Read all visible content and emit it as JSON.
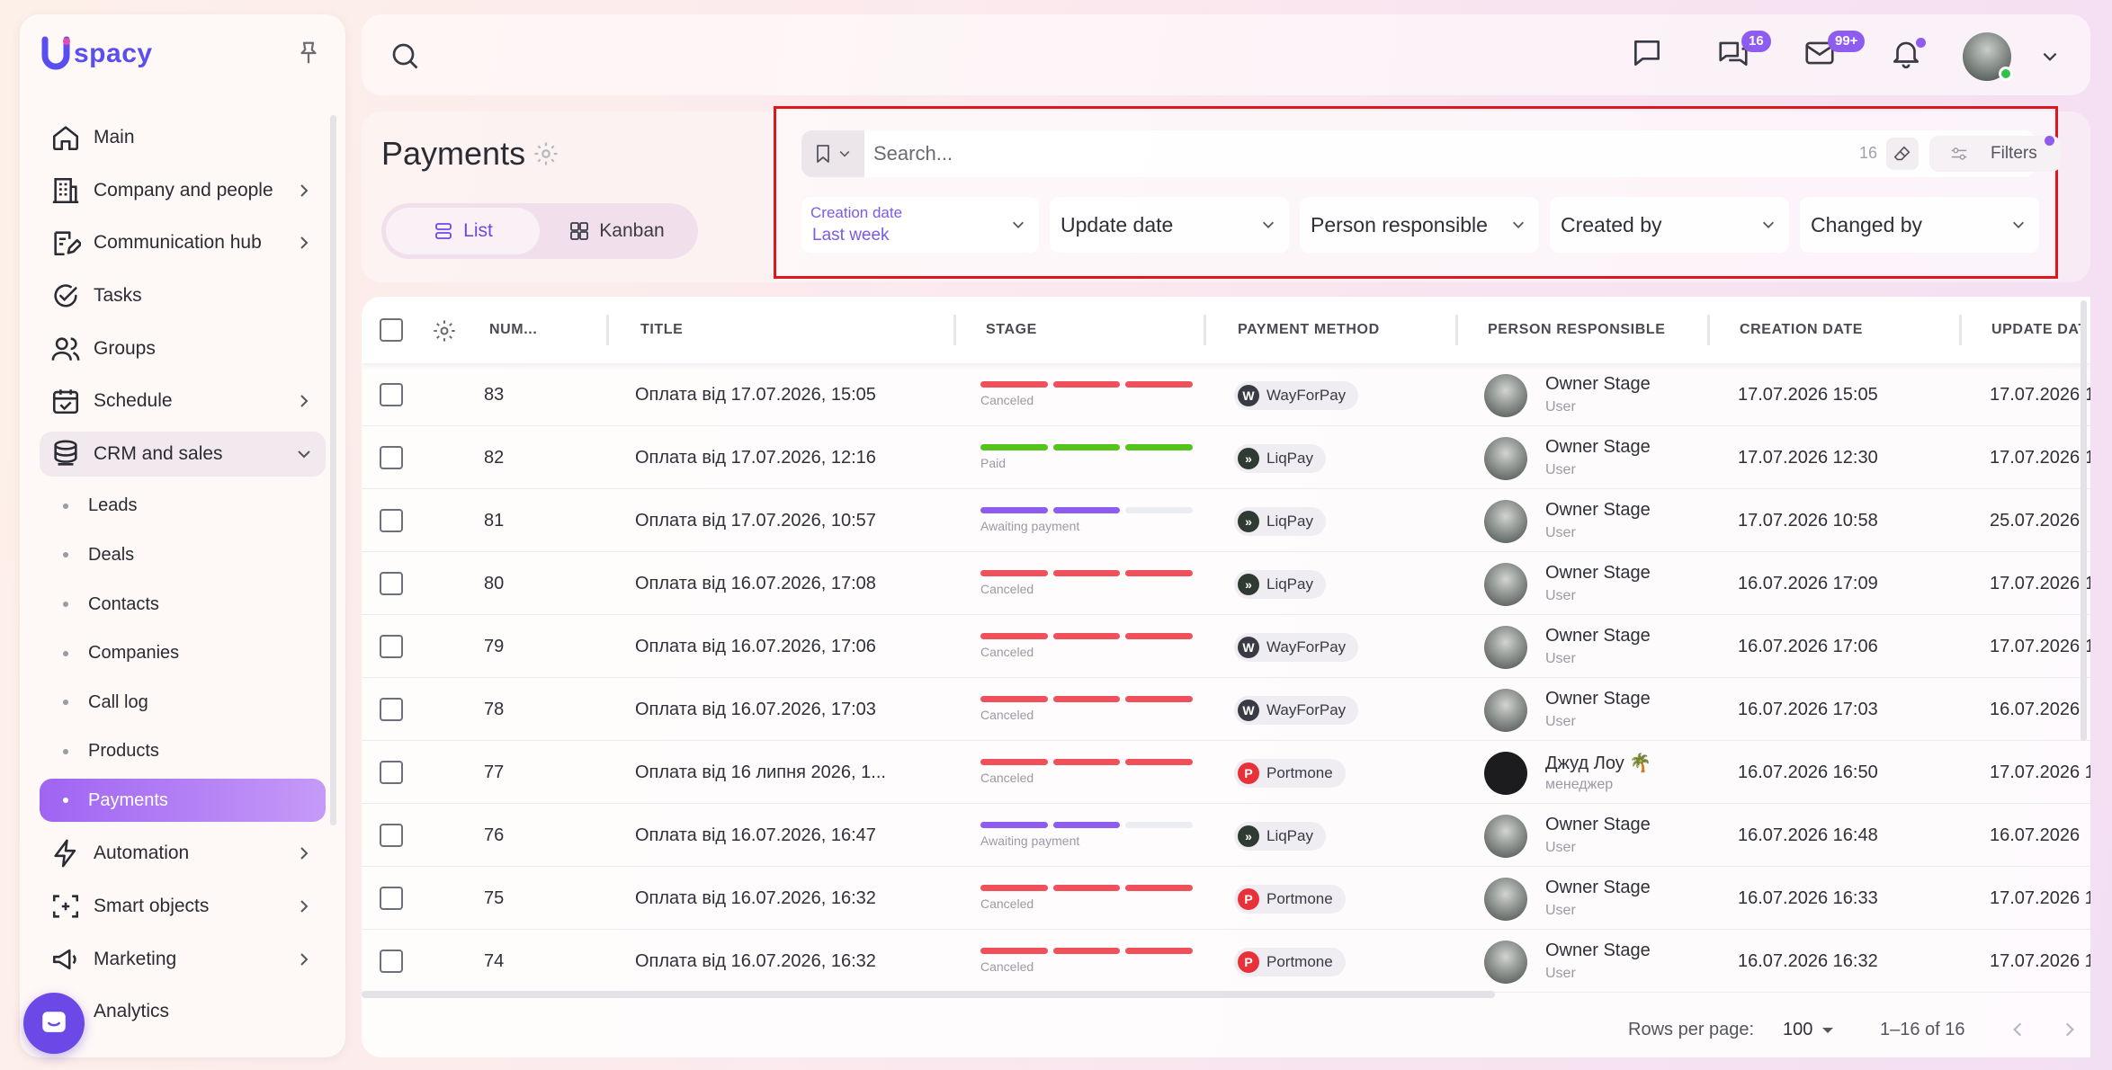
{
  "app": {
    "logo_text": "spacy"
  },
  "sidebar": {
    "items": [
      {
        "label": "Main",
        "icon": "home-icon",
        "chevron": false
      },
      {
        "label": "Company and people",
        "icon": "building-icon",
        "chevron": true
      },
      {
        "label": "Communication hub",
        "icon": "edit-note-icon",
        "chevron": true
      },
      {
        "label": "Tasks",
        "icon": "check-circle-icon",
        "chevron": false
      },
      {
        "label": "Groups",
        "icon": "people-icon",
        "chevron": false
      },
      {
        "label": "Schedule",
        "icon": "calendar-icon",
        "chevron": true
      },
      {
        "label": "CRM and sales",
        "icon": "database-icon",
        "chevron": true
      }
    ],
    "crm_sub": [
      "Leads",
      "Deals",
      "Contacts",
      "Companies",
      "Call log",
      "Products",
      "Payments"
    ],
    "after": [
      {
        "label": "Automation",
        "icon": "lightning-icon"
      },
      {
        "label": "Smart objects",
        "icon": "smart-object-icon"
      },
      {
        "label": "Marketing",
        "icon": "megaphone-icon"
      },
      {
        "label": "Analytics",
        "icon": "chart-icon"
      }
    ]
  },
  "topbar": {
    "chat_badge": "16",
    "mail_badge": "99+"
  },
  "page": {
    "title": "Payments",
    "views": {
      "list": "List",
      "kanban": "Kanban"
    }
  },
  "search": {
    "placeholder": "Search...",
    "count": "16",
    "filters_label": "Filters"
  },
  "filters": {
    "creation_date_label": "Creation date",
    "creation_date_value": "Last week",
    "update_date": "Update date",
    "person_responsible": "Person responsible",
    "created_by": "Created by",
    "changed_by": "Changed by"
  },
  "table": {
    "headers": {
      "number": "NUM...",
      "title": "TITLE",
      "stage": "STAGE",
      "payment_method": "PAYMENT METHOD",
      "person": "PERSON RESPONSIBLE",
      "created": "CREATION DATE",
      "updated": "UPDATE DAT"
    },
    "rows": [
      {
        "num": "83",
        "title": "Оплата від 17.07.2026, 15:05",
        "stage": "Canceled",
        "method": "WayForPay",
        "person": "Owner Stage",
        "role": "User",
        "created": "17.07.2026 15:05",
        "updated": "17.07.2026 1"
      },
      {
        "num": "82",
        "title": "Оплата від 17.07.2026, 12:16",
        "stage": "Paid",
        "method": "LiqPay",
        "person": "Owner Stage",
        "role": "User",
        "created": "17.07.2026 12:30",
        "updated": "17.07.2026 1"
      },
      {
        "num": "81",
        "title": "Оплата від 17.07.2026, 10:57",
        "stage": "Awaiting payment",
        "method": "LiqPay",
        "person": "Owner Stage",
        "role": "User",
        "created": "17.07.2026 10:58",
        "updated": "25.07.2026"
      },
      {
        "num": "80",
        "title": "Оплата від 16.07.2026, 17:08",
        "stage": "Canceled",
        "method": "LiqPay",
        "person": "Owner Stage",
        "role": "User",
        "created": "16.07.2026 17:09",
        "updated": "17.07.2026 1"
      },
      {
        "num": "79",
        "title": "Оплата від 16.07.2026, 17:06",
        "stage": "Canceled",
        "method": "WayForPay",
        "person": "Owner Stage",
        "role": "User",
        "created": "16.07.2026 17:06",
        "updated": "17.07.2026 1"
      },
      {
        "num": "78",
        "title": "Оплата від 16.07.2026, 17:03",
        "stage": "Canceled",
        "method": "WayForPay",
        "person": "Owner Stage",
        "role": "User",
        "created": "16.07.2026 17:03",
        "updated": "16.07.2026"
      },
      {
        "num": "77",
        "title": "Оплата від 16 липня 2026, 1...",
        "stage": "Canceled",
        "method": "Portmone",
        "person": "Джуд Лоу 🌴",
        "role": "менеджер",
        "created": "16.07.2026 16:50",
        "updated": "17.07.2026 1"
      },
      {
        "num": "76",
        "title": "Оплата від 16.07.2026, 16:47",
        "stage": "Awaiting payment",
        "method": "LiqPay",
        "person": "Owner Stage",
        "role": "User",
        "created": "16.07.2026 16:48",
        "updated": "16.07.2026"
      },
      {
        "num": "75",
        "title": "Оплата від 16.07.2026, 16:32",
        "stage": "Canceled",
        "method": "Portmone",
        "person": "Owner Stage",
        "role": "User",
        "created": "16.07.2026 16:33",
        "updated": "17.07.2026 1"
      },
      {
        "num": "74",
        "title": "Оплата від 16.07.2026, 16:32",
        "stage": "Canceled",
        "method": "Portmone",
        "person": "Owner Stage",
        "role": "User",
        "created": "16.07.2026 16:32",
        "updated": "17.07.2026 1"
      }
    ]
  },
  "pagination": {
    "rows_per_page_label": "Rows per page:",
    "rows_per_page": "100",
    "range": "1–16 of 16"
  },
  "colors": {
    "accent": "#8f5cf0",
    "canceled": "#f0505a",
    "paid": "#52c41a",
    "awaiting": "#8f5cf0",
    "highlight_box": "#e0161d"
  }
}
